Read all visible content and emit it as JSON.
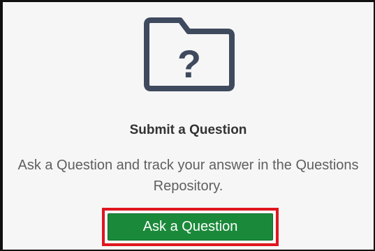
{
  "card": {
    "icon": "folder-question-icon",
    "icon_glyph": "?",
    "title": "Submit a Question",
    "description": "Ask a Question and track your answer in the Questions Repository.",
    "button_label": "Ask a Question"
  },
  "colors": {
    "icon": "#3f4a5e",
    "button": "#1a8a3a",
    "highlight_border": "#e0161e",
    "background": "#f6f6f7"
  }
}
